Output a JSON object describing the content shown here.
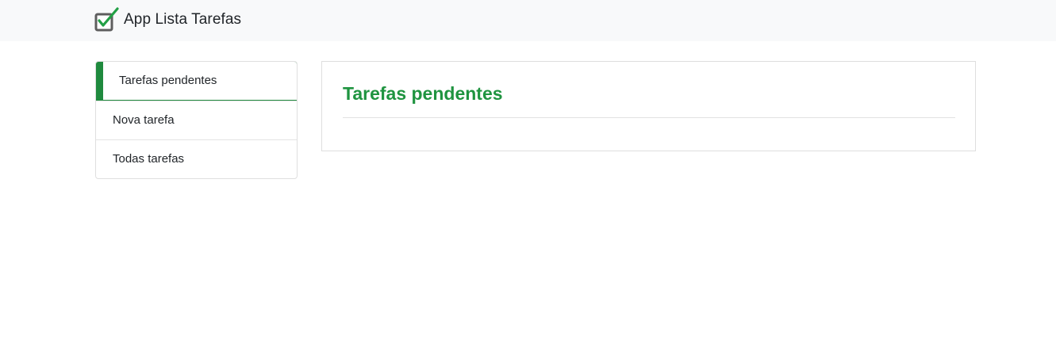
{
  "navbar": {
    "brand_text": "App Lista Tarefas",
    "brand_icon": "checkbox-check-icon"
  },
  "menu": {
    "items": [
      {
        "label": "Tarefas pendentes",
        "active": true
      },
      {
        "label": "Nova tarefa",
        "active": false
      },
      {
        "label": "Todas tarefas",
        "active": false
      }
    ]
  },
  "main": {
    "title": "Tarefas pendentes"
  },
  "colors": {
    "accent": "#1f8a3e",
    "title": "#1f9440",
    "navbar_bg": "#f8f9fa"
  }
}
